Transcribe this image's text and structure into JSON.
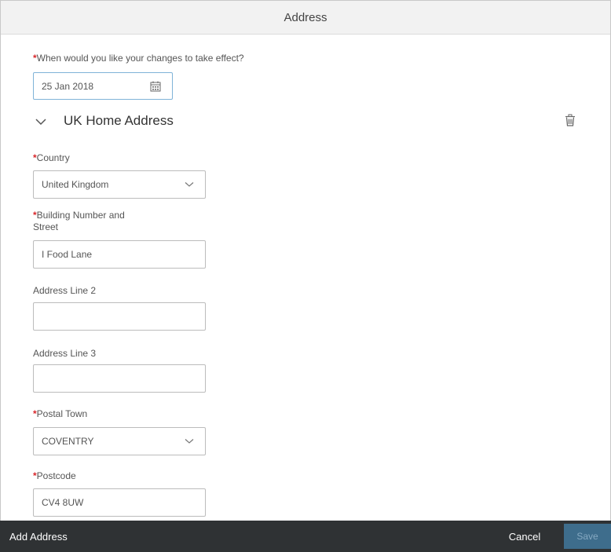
{
  "header": {
    "title": "Address"
  },
  "effective": {
    "label": "When would you like your changes to take effect?",
    "value": "25 Jan 2018"
  },
  "section": {
    "title": "UK Home Address"
  },
  "fields": {
    "country": {
      "label": "Country",
      "value": "United Kingdom"
    },
    "building": {
      "label_line1": "Building Number and",
      "label_line2": "Street",
      "value": "I Food Lane"
    },
    "address2": {
      "label": "Address Line 2",
      "value": ""
    },
    "address3": {
      "label": "Address Line 3",
      "value": ""
    },
    "town": {
      "label": "Postal Town",
      "value": "COVENTRY"
    },
    "postcode": {
      "label": "Postcode",
      "value": "CV4 8UW"
    }
  },
  "required_marker": "*",
  "footer": {
    "add_label": "Add Address",
    "cancel_label": "Cancel",
    "save_label": "Save"
  },
  "colors": {
    "required": "#d9262a",
    "footer_bg": "#2f3234",
    "save_bg": "#3e6d8c"
  },
  "icons": [
    "calendar-icon",
    "chevron-down-icon",
    "trash-icon"
  ]
}
